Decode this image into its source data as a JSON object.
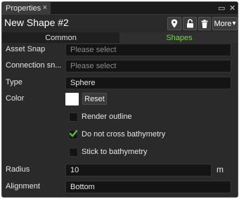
{
  "window": {
    "tab_label": "Properties",
    "tab_close": "×",
    "maximize": "▭",
    "close": "✕"
  },
  "header": {
    "title": "New Shape #2",
    "more_label": "More",
    "more_caret": "▾"
  },
  "subtabs": {
    "common": "Common",
    "shapes": "Shapes",
    "active_color": "#7bd44d"
  },
  "fields": {
    "asset_snap": {
      "label": "Asset Snap",
      "placeholder": "Please select"
    },
    "connection_snap": {
      "label": "Connection sn...",
      "placeholder": "Please select"
    },
    "type": {
      "label": "Type",
      "value": "Sphere"
    },
    "color": {
      "label": "Color",
      "swatch": "#ffffff",
      "reset_label": "Reset"
    },
    "radius": {
      "label": "Radius",
      "value": "10",
      "unit": "m"
    },
    "alignment": {
      "label": "Alignment",
      "value": "Bottom"
    }
  },
  "checkboxes": [
    {
      "label": "Render outline",
      "checked": false
    },
    {
      "label": "Do not cross bathymetry",
      "checked": true
    },
    {
      "label": "Stick to bathymetry",
      "checked": false
    }
  ],
  "icons": [
    "close-icon",
    "maximize-icon",
    "pin-icon",
    "lock-icon",
    "trash-icon",
    "chevron-down-icon",
    "checkmark-icon"
  ]
}
